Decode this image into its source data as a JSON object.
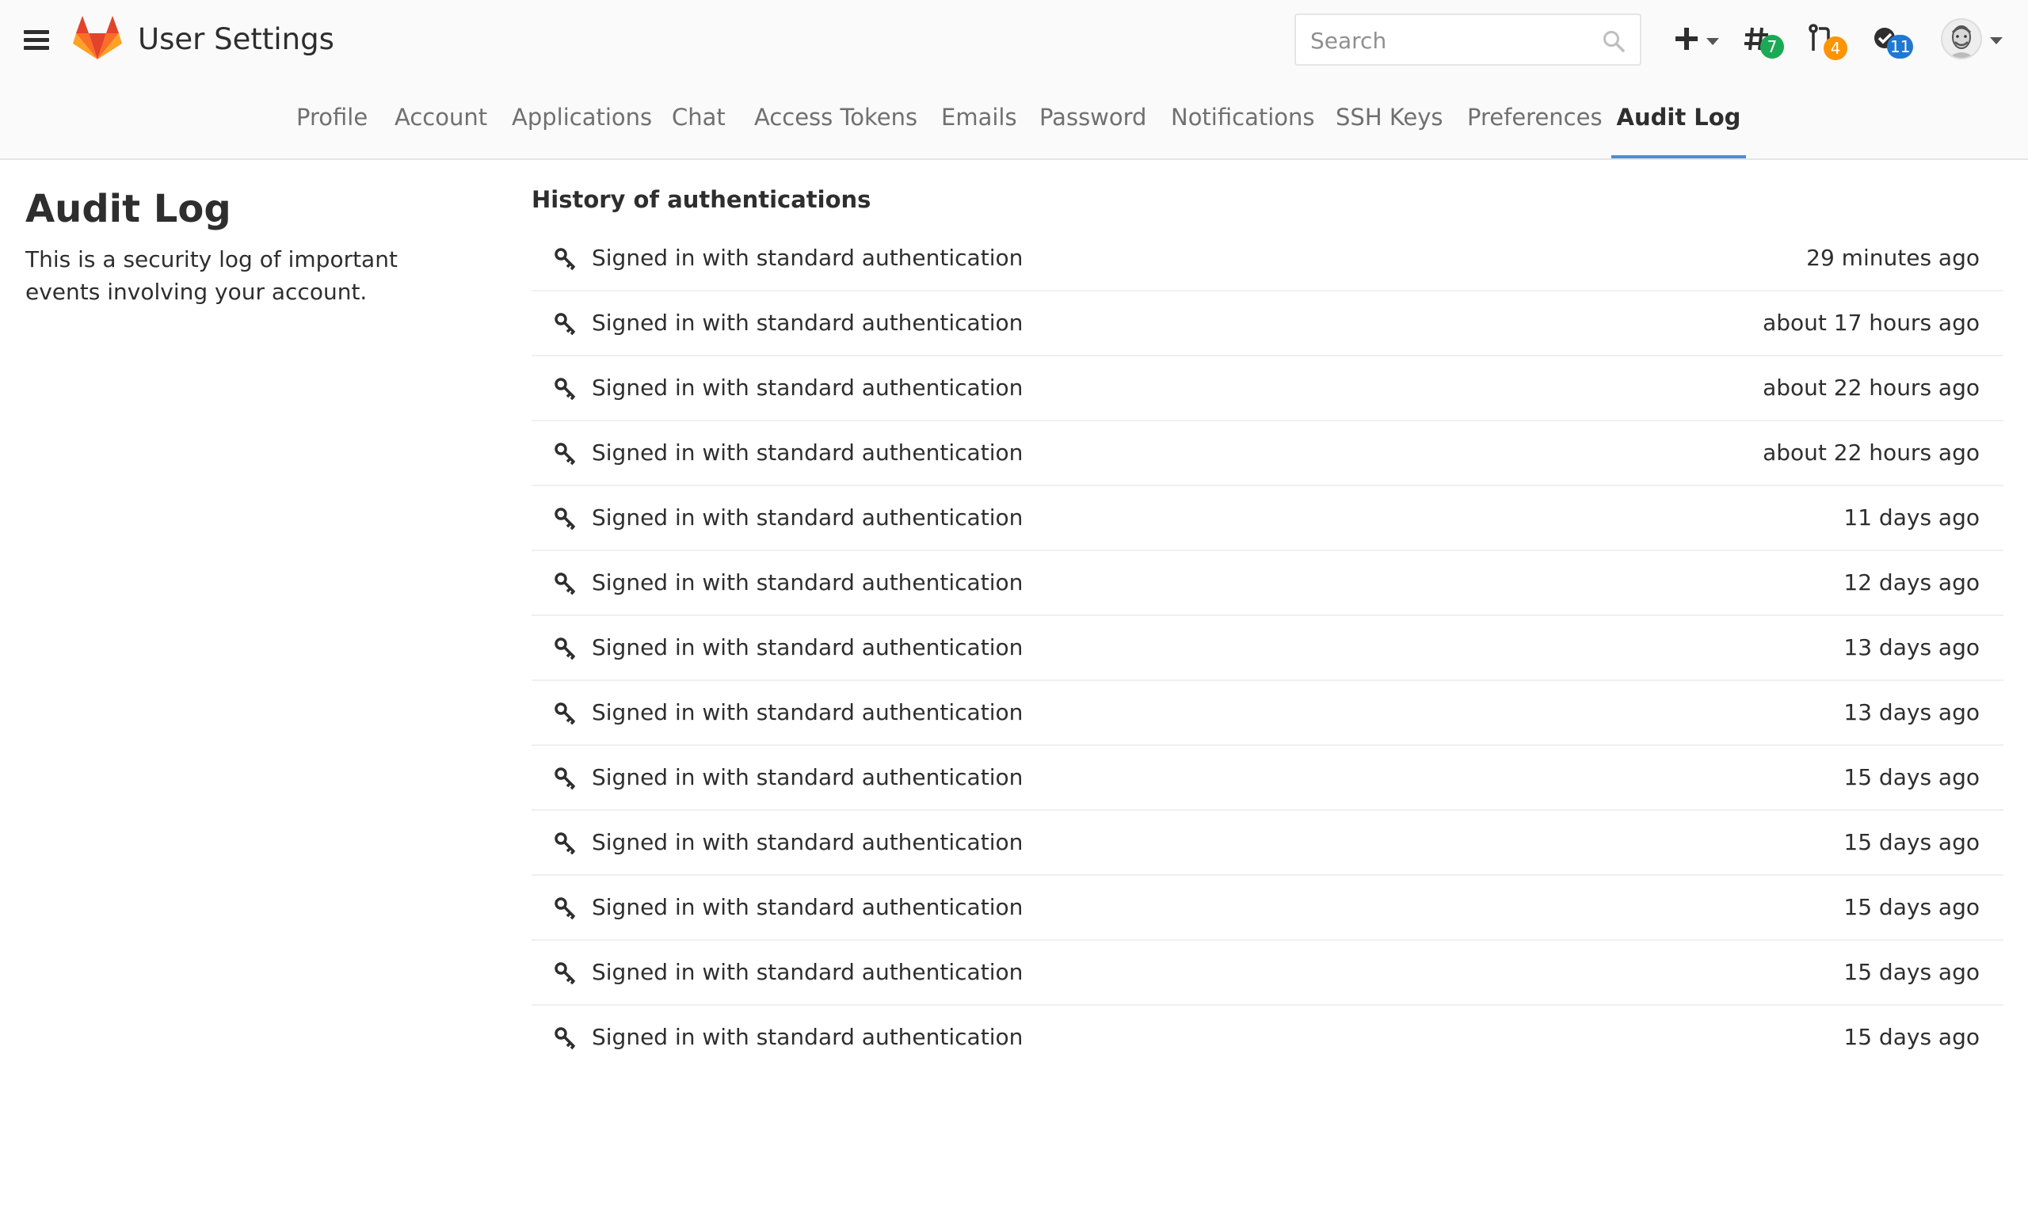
{
  "header": {
    "title": "User Settings",
    "search_placeholder": "Search",
    "new_menu_icon": "plus-icon",
    "issues_count": "7",
    "merge_requests_count": "4",
    "todos_count": "11",
    "colors": {
      "issues_badge": "#1aaa55",
      "merge_requests_badge": "#fc9403",
      "todos_badge": "#1f78d1",
      "active_tab_underline": "#4c8fd6"
    }
  },
  "tabs": [
    {
      "label": "Profile"
    },
    {
      "label": "Account"
    },
    {
      "label": "Applications"
    },
    {
      "label": "Chat"
    },
    {
      "label": "Access Tokens"
    },
    {
      "label": "Emails"
    },
    {
      "label": "Password"
    },
    {
      "label": "Notifications"
    },
    {
      "label": "SSH Keys"
    },
    {
      "label": "Preferences"
    },
    {
      "label": "Audit Log",
      "active": true
    }
  ],
  "sidebar": {
    "title": "Audit Log",
    "description": "This is a security log of important events involving your account."
  },
  "history": {
    "title": "History of authentications",
    "icon": "key-icon",
    "entries": [
      {
        "text": "Signed in with standard authentication",
        "time": "29 minutes ago"
      },
      {
        "text": "Signed in with standard authentication",
        "time": "about 17 hours ago"
      },
      {
        "text": "Signed in with standard authentication",
        "time": "about 22 hours ago"
      },
      {
        "text": "Signed in with standard authentication",
        "time": "about 22 hours ago"
      },
      {
        "text": "Signed in with standard authentication",
        "time": "11 days ago"
      },
      {
        "text": "Signed in with standard authentication",
        "time": "12 days ago"
      },
      {
        "text": "Signed in with standard authentication",
        "time": "13 days ago"
      },
      {
        "text": "Signed in with standard authentication",
        "time": "13 days ago"
      },
      {
        "text": "Signed in with standard authentication",
        "time": "15 days ago"
      },
      {
        "text": "Signed in with standard authentication",
        "time": "15 days ago"
      },
      {
        "text": "Signed in with standard authentication",
        "time": "15 days ago"
      },
      {
        "text": "Signed in with standard authentication",
        "time": "15 days ago"
      },
      {
        "text": "Signed in with standard authentication",
        "time": "15 days ago"
      }
    ]
  }
}
